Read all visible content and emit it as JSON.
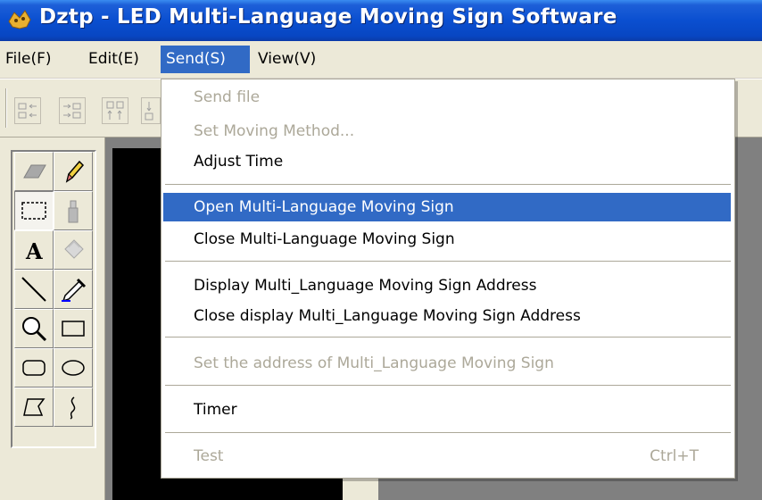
{
  "window": {
    "title": "Dztp - LED Multi-Language Moving Sign Software"
  },
  "menubar": {
    "items": [
      {
        "label": "File(F)"
      },
      {
        "label": "Edit(E)"
      },
      {
        "label": "Send(S)"
      },
      {
        "label": "View(V)"
      }
    ],
    "active": "Send(S)"
  },
  "send_menu": {
    "items": [
      {
        "label": "Send file",
        "enabled": false
      },
      {
        "label": "Set Moving Method...",
        "enabled": false
      },
      {
        "label": "Adjust Time",
        "enabled": true
      },
      {
        "label": "Open Multi-Language Moving Sign",
        "enabled": true,
        "highlighted": true
      },
      {
        "label": "Close Multi-Language Moving Sign",
        "enabled": true
      },
      {
        "label": "Display Multi_Language Moving Sign Address",
        "enabled": true
      },
      {
        "label": "Close display Multi_Language Moving Sign Address",
        "enabled": true
      },
      {
        "label": "Set the address of Multi_Language Moving Sign",
        "enabled": false
      },
      {
        "label": "Timer",
        "enabled": true
      },
      {
        "label": "Test",
        "enabled": false,
        "shortcut": "Ctrl+T"
      }
    ]
  },
  "toolbar": {
    "buttons": [
      "align-left-icon",
      "align-right-icon",
      "align-top-icon",
      "align-bottom-icon"
    ]
  },
  "palette": {
    "tools": [
      "eraser-icon",
      "pencil-icon",
      "rect-select-icon",
      "airbrush-icon",
      "text-icon",
      "fill-icon",
      "line-icon",
      "color-picker-icon",
      "zoom-icon",
      "rectangle-icon",
      "rounded-rect-icon",
      "ellipse-icon",
      "polygon-icon",
      "curve-icon"
    ],
    "selected": "rect-select-icon"
  },
  "colors": {
    "title_bar": "#0a4fd0",
    "menu_highlight": "#316ac5",
    "face": "#ece9d8",
    "disabled_text": "#aca899"
  }
}
